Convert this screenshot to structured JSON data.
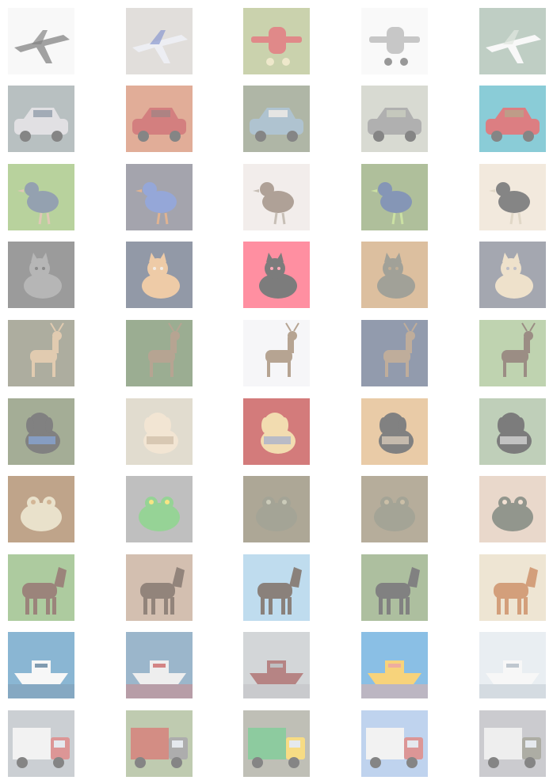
{
  "grid": {
    "rows": [
      {
        "tiles": [
          {
            "subject": "jet-dark",
            "bg": "#f2f2f2",
            "fg": "#555555",
            "accent": "#222222"
          },
          {
            "subject": "jet-fighter",
            "bg": "#c9c4be",
            "fg": "#dfe1ea",
            "accent": "#2a44a8"
          },
          {
            "subject": "biplane",
            "bg": "#9fae6a",
            "fg": "#c62828",
            "accent": "#e0d6a0"
          },
          {
            "subject": "propeller-plane",
            "bg": "#f4f4f4",
            "fg": "#9a9a9a",
            "accent": "#444444"
          },
          {
            "subject": "jet-sky",
            "bg": "#8aa694",
            "fg": "#f2f2f2",
            "accent": "#c9d4c8"
          }
        ]
      },
      {
        "tiles": [
          {
            "subject": "car-sedan",
            "bg": "#7f8c8f",
            "fg": "#c9c6cc",
            "accent": "#3a4d66"
          },
          {
            "subject": "car-sports",
            "bg": "#c86a44",
            "fg": "#b01616",
            "accent": "#5a2020"
          },
          {
            "subject": "car-pickup",
            "bg": "#6d7b5d",
            "fg": "#6d93a9",
            "accent": "#e8e0d6"
          },
          {
            "subject": "car-suv",
            "bg": "#b9bcae",
            "fg": "#6f6f6f",
            "accent": "#9fa88f"
          },
          {
            "subject": "car-red",
            "bg": "#2aa2b6",
            "fg": "#c0141c",
            "accent": "#7a5a2a"
          }
        ]
      },
      {
        "tiles": [
          {
            "subject": "bird-cassowary",
            "bg": "#7fae4e",
            "fg": "#3d5570",
            "accent": "#c79a7a"
          },
          {
            "subject": "bird-bluebird",
            "bg": "#5a5a6a",
            "fg": "#3f5fb8",
            "accent": "#c7763a"
          },
          {
            "subject": "bird-sparrow",
            "bg": "#e8dfda",
            "fg": "#6d5542",
            "accent": "#9a8a7a"
          },
          {
            "subject": "bird-peacock",
            "bg": "#6d8a4a",
            "fg": "#22407a",
            "accent": "#a0c858"
          },
          {
            "subject": "bird-ostrich",
            "bg": "#e8d7c2",
            "fg": "#222222",
            "accent": "#c8b89a"
          }
        ]
      },
      {
        "tiles": [
          {
            "subject": "cat-grey",
            "bg": "#4a4a4a",
            "fg": "#7a7a7a",
            "accent": "#2a2a2a"
          },
          {
            "subject": "cat-ginger",
            "bg": "#3a4560",
            "fg": "#e0a060",
            "accent": "#e8dcd0"
          },
          {
            "subject": "cat-black",
            "bg": "#ff3355",
            "fg": "#111111",
            "accent": "#ff6680"
          },
          {
            "subject": "cat-tabby",
            "bg": "#c08a50",
            "fg": "#555544",
            "accent": "#8a6a40"
          },
          {
            "subject": "cat-cream",
            "bg": "#5a6070",
            "fg": "#e0c8a0",
            "accent": "#8a8a9a"
          }
        ]
      },
      {
        "tiles": [
          {
            "subject": "deer-field",
            "bg": "#6a6a50",
            "fg": "#c8a070",
            "accent": "#7a8a5a"
          },
          {
            "subject": "deer-grass",
            "bg": "#4a6a3a",
            "fg": "#7a5a3a",
            "accent": "#5a7a4a"
          },
          {
            "subject": "deer-snow",
            "bg": "#eeeef2",
            "fg": "#7a5a3a",
            "accent": "#c8c8d0"
          },
          {
            "subject": "deer-moose",
            "bg": "#3a4a6a",
            "fg": "#8a6a4a",
            "accent": "#e8d8b8"
          },
          {
            "subject": "deer-elk",
            "bg": "#8ab070",
            "fg": "#4a3020",
            "accent": "#b0d0a0"
          }
        ]
      },
      {
        "tiles": [
          {
            "subject": "dog-blue",
            "bg": "#5a6a40",
            "fg": "#1a1a1a",
            "accent": "#2a70e0"
          },
          {
            "subject": "dog-fluffy",
            "bg": "#c8c0a8",
            "fg": "#e8d0b0",
            "accent": "#9a7a50"
          },
          {
            "subject": "dog-chi",
            "bg": "#b01010",
            "fg": "#e8c070",
            "accent": "#3a5ab0"
          },
          {
            "subject": "dog-puppy",
            "bg": "#d8a060",
            "fg": "#1a1a1a",
            "accent": "#e8c8a0"
          },
          {
            "subject": "dog-husky",
            "bg": "#8aa880",
            "fg": "#111111",
            "accent": "#e8e8e8"
          }
        ]
      },
      {
        "tiles": [
          {
            "subject": "frog-brown",
            "bg": "#8a5a2a",
            "fg": "#d8c8a0",
            "accent": "#b07a40"
          },
          {
            "subject": "frog-green",
            "bg": "#8a8a8a",
            "fg": "#40b040",
            "accent": "#f0d020"
          },
          {
            "subject": "frog-toad",
            "bg": "#6a6040",
            "fg": "#5a5a40",
            "accent": "#a0a080"
          },
          {
            "subject": "frog-rock",
            "bg": "#7a6a4a",
            "fg": "#5a5a40",
            "accent": "#a08a60"
          },
          {
            "subject": "frog-hand",
            "bg": "#d8b8a0",
            "fg": "#3a4030",
            "accent": "#e8c8b0"
          }
        ]
      },
      {
        "tiles": [
          {
            "subject": "horse-brown",
            "bg": "#6aa050",
            "fg": "#4a2010",
            "accent": "#8ac070"
          },
          {
            "subject": "horse-rider",
            "bg": "#b08a70",
            "fg": "#3a2010",
            "accent": "#e0d8d0"
          },
          {
            "subject": "horse-field",
            "bg": "#8ac0e0",
            "fg": "#2a1a10",
            "accent": "#60a040"
          },
          {
            "subject": "horse-pinto",
            "bg": "#6a8a50",
            "fg": "#1a1a1a",
            "accent": "#e8e8e8"
          },
          {
            "subject": "horse-chestnut",
            "bg": "#e0d0b0",
            "fg": "#b05010",
            "accent": "#e8d8c0"
          }
        ]
      },
      {
        "tiles": [
          {
            "subject": "ship-speedboat",
            "bg": "#2a7ab0",
            "fg": "#f0f0f0",
            "accent": "#1a4a70"
          },
          {
            "subject": "ship-fishing",
            "bg": "#4a7aa0",
            "fg": "#e0e0e0",
            "accent": "#b02020"
          },
          {
            "subject": "ship-tanker",
            "bg": "#b0b4b8",
            "fg": "#7a2020",
            "accent": "#8a8a90"
          },
          {
            "subject": "ship-banana",
            "bg": "#2a8ad0",
            "fg": "#f0b010",
            "accent": "#e06a50"
          },
          {
            "subject": "ship-yacht",
            "bg": "#d8e0e8",
            "fg": "#f0f0f0",
            "accent": "#8a9aa8"
          }
        ]
      },
      {
        "tiles": [
          {
            "subject": "truck-white",
            "bg": "#a0a8b0",
            "fg": "#e8e8e8",
            "accent": "#c04040"
          },
          {
            "subject": "truck-dump",
            "bg": "#8aa070",
            "fg": "#b03020",
            "accent": "#6a6a6a"
          },
          {
            "subject": "truck-green",
            "bg": "#8a8a7a",
            "fg": "#30a050",
            "accent": "#f0c020"
          },
          {
            "subject": "truck-trailer",
            "bg": "#8ab0e0",
            "fg": "#e8e8e8",
            "accent": "#c04040"
          },
          {
            "subject": "truck-house",
            "bg": "#a0a0a8",
            "fg": "#e0e0e0",
            "accent": "#6a6a5a"
          }
        ]
      }
    ]
  }
}
